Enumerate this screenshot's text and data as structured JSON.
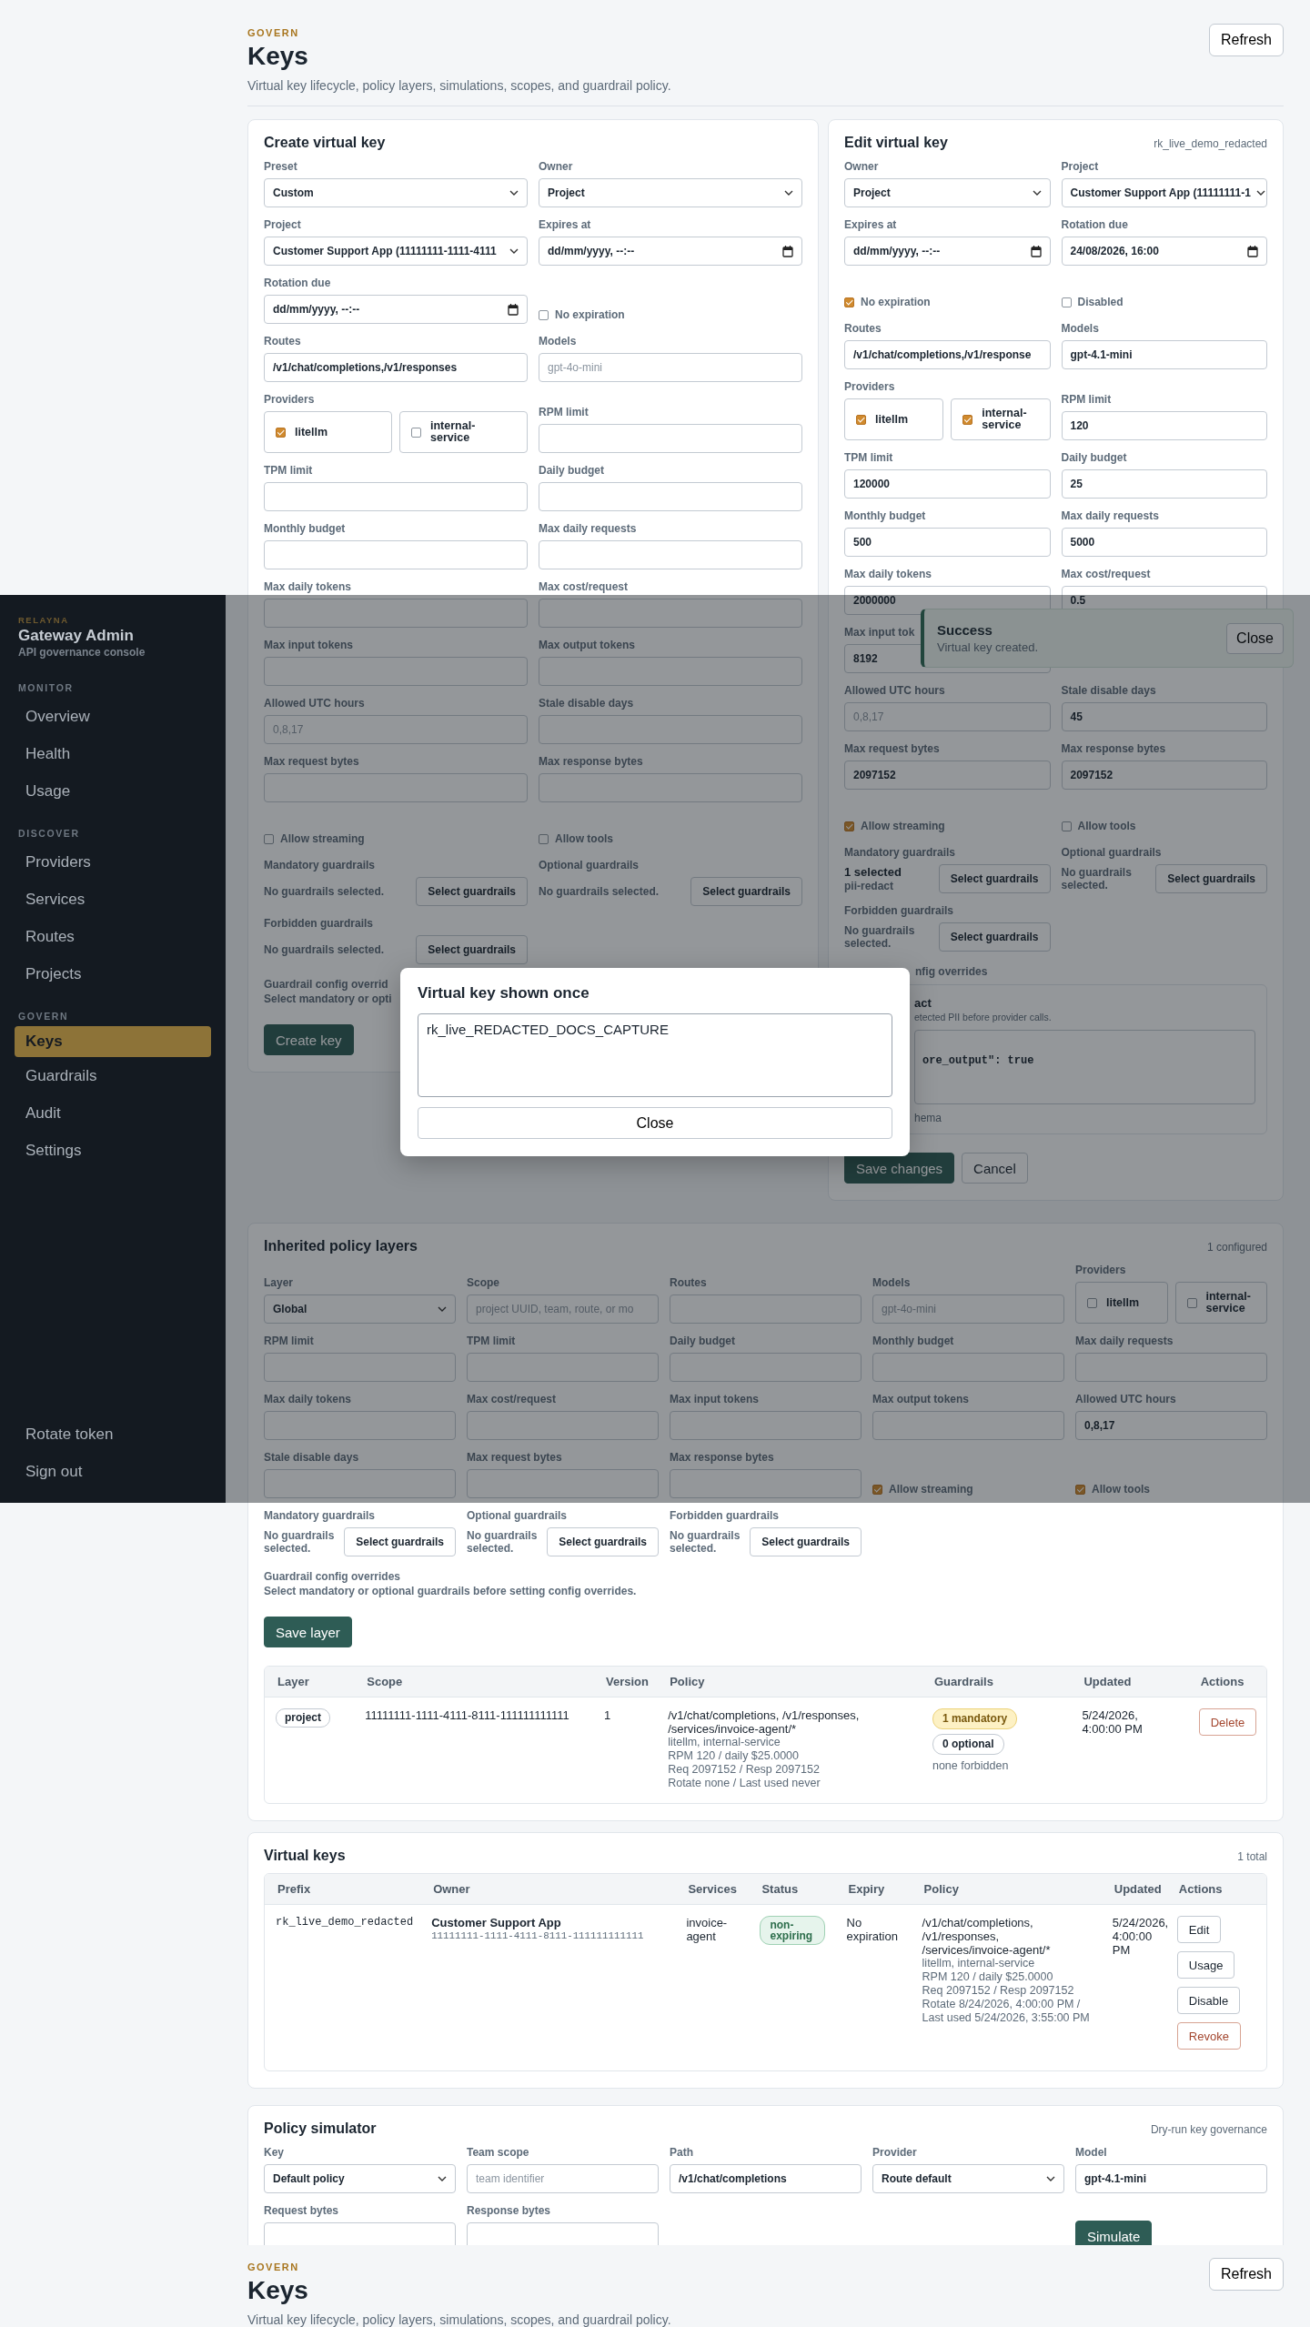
{
  "page_header": {
    "eyebrow": "GOVERN",
    "title": "Keys",
    "subtitle": "Virtual key lifecycle, policy layers, simulations, scopes, and guardrail policy.",
    "refresh": "Refresh"
  },
  "create_card": {
    "title": "Create virtual key",
    "fields": [
      {
        "kind": "select",
        "label": "Preset",
        "value": "Custom"
      },
      {
        "kind": "select",
        "label": "Owner",
        "value": "Project"
      },
      {
        "kind": "select",
        "label": "Project",
        "value": "Customer Support App (11111111-1111-4111"
      },
      {
        "kind": "date",
        "label": "Expires at",
        "value": "dd/mm/yyyy, --:--"
      },
      {
        "kind": "date",
        "label": "Rotation due",
        "value": "dd/mm/yyyy, --:--"
      },
      {
        "kind": "checkbox",
        "label": "No expiration",
        "checked": false
      },
      {
        "kind": "input",
        "label": "Routes",
        "value": "/v1/chat/completions,/v1/responses"
      },
      {
        "kind": "input",
        "label": "Models",
        "placeholder": "gpt-4o-mini"
      },
      {
        "kind": "providers",
        "label": "Providers",
        "options": [
          {
            "label": "litellm",
            "checked": true
          },
          {
            "label": "internal-service",
            "checked": false
          }
        ]
      },
      {
        "kind": "input",
        "label": "RPM limit"
      },
      {
        "kind": "input",
        "label": "TPM limit"
      },
      {
        "kind": "input",
        "label": "Daily budget"
      },
      {
        "kind": "input",
        "label": "Monthly budget"
      },
      {
        "kind": "input",
        "label": "Max daily requests"
      },
      {
        "kind": "input",
        "label": "Max daily tokens"
      },
      {
        "kind": "input",
        "label": "Max cost/request"
      },
      {
        "kind": "input",
        "label": "Max input tokens"
      },
      {
        "kind": "input",
        "label": "Max output tokens"
      },
      {
        "kind": "input",
        "label": "Allowed UTC hours",
        "placeholder": "0,8,17"
      },
      {
        "kind": "input",
        "label": "Stale disable days"
      },
      {
        "kind": "input",
        "label": "Max request bytes"
      },
      {
        "kind": "input",
        "label": "Max response bytes"
      },
      {
        "kind": "checkbox",
        "label": "Allow streaming",
        "checked": false
      },
      {
        "kind": "checkbox",
        "label": "Allow tools",
        "checked": false
      },
      {
        "kind": "guardrails",
        "label": "Mandatory guardrails",
        "summary": "No guardrails selected.",
        "button": "Select guardrails"
      },
      {
        "kind": "guardrails",
        "label": "Optional guardrails",
        "summary": "No guardrails selected.",
        "button": "Select guardrails"
      },
      {
        "kind": "guardrails",
        "label": "Forbidden guardrails",
        "summary": "No guardrails selected.",
        "button": "Select guardrails"
      }
    ],
    "config_note": {
      "label": "Guardrail config overrid",
      "text": "Select mandatory or opti"
    },
    "buttons": [
      "Create key"
    ]
  },
  "edit_card": {
    "title": "Edit virtual key",
    "meta": "rk_live_demo_redacted",
    "fields": [
      {
        "kind": "select",
        "label": "Owner",
        "value": "Project"
      },
      {
        "kind": "select",
        "label": "Project",
        "value": "Customer Support App (11111111-1"
      },
      {
        "kind": "date",
        "label": "Expires at",
        "value": "dd/mm/yyyy, --:--"
      },
      {
        "kind": "date",
        "label": "Rotation due",
        "value": "24/08/2026, 16:00"
      },
      {
        "kind": "checkbox",
        "label": "No expiration",
        "checked": true
      },
      {
        "kind": "checkbox",
        "label": "Disabled",
        "checked": false
      },
      {
        "kind": "input",
        "label": "Routes",
        "value": "/v1/chat/completions,/v1/response"
      },
      {
        "kind": "input",
        "label": "Models",
        "value": "gpt-4.1-mini"
      },
      {
        "kind": "providers",
        "label": "Providers",
        "options": [
          {
            "label": "litellm",
            "checked": true
          },
          {
            "label": "internal-service",
            "checked": true
          }
        ]
      },
      {
        "kind": "input",
        "label": "RPM limit",
        "value": "120"
      },
      {
        "kind": "input",
        "label": "TPM limit",
        "value": "120000"
      },
      {
        "kind": "input",
        "label": "Daily budget",
        "value": "25"
      },
      {
        "kind": "input",
        "label": "Monthly budget",
        "value": "500"
      },
      {
        "kind": "input",
        "label": "Max daily requests",
        "value": "5000"
      },
      {
        "kind": "input",
        "label": "Max daily tokens",
        "value": "2000000"
      },
      {
        "kind": "input",
        "label": "Max cost/request",
        "value": "0.5"
      },
      {
        "kind": "input",
        "label": "Max input tok",
        "value": "8192"
      },
      {
        "kind": "gap"
      },
      {
        "kind": "input",
        "label": "Allowed UTC hours",
        "placeholder": "0,8,17"
      },
      {
        "kind": "input",
        "label": "Stale disable days",
        "value": "45"
      },
      {
        "kind": "input",
        "label": "Max request bytes",
        "value": "2097152"
      },
      {
        "kind": "input",
        "label": "Max response bytes",
        "value": "2097152"
      },
      {
        "kind": "checkbox",
        "label": "Allow streaming",
        "checked": true
      },
      {
        "kind": "checkbox",
        "label": "Allow tools",
        "checked": false
      },
      {
        "kind": "guardrails",
        "label": "Mandatory guardrails",
        "summary": "1 selected",
        "items": [
          "pii-redact"
        ],
        "button": "Select guardrails"
      },
      {
        "kind": "guardrails",
        "label": "Optional guardrails",
        "summary": "No guardrails selected.",
        "button": "Select guardrails"
      },
      {
        "kind": "guardrails",
        "label": "Forbidden guardrails",
        "summary": "No guardrails selected.",
        "button": "Select guardrails"
      }
    ],
    "config": {
      "label": "nfig overrides",
      "name": "act",
      "description": "etected PII before provider calls.",
      "json": "ore_output\": true",
      "footer": "hema"
    },
    "buttons": [
      "Save changes",
      "Cancel"
    ]
  },
  "layers_card": {
    "title": "Inherited policy layers",
    "meta": "1 configured",
    "fields": [
      {
        "kind": "select",
        "label": "Layer",
        "value": "Global"
      },
      {
        "kind": "input",
        "label": "Scope",
        "placeholder": "project UUID, team, route, or mo"
      },
      {
        "kind": "input",
        "label": "Routes"
      },
      {
        "kind": "input",
        "label": "Models",
        "placeholder": "gpt-4o-mini"
      },
      {
        "kind": "providers",
        "label": "Providers",
        "options": [
          {
            "label": "litellm",
            "checked": false
          },
          {
            "label": "internal-service",
            "checked": false
          }
        ]
      },
      {
        "kind": "input",
        "label": "RPM limit"
      },
      {
        "kind": "input",
        "label": "TPM limit"
      },
      {
        "kind": "input",
        "label": "Daily budget"
      },
      {
        "kind": "input",
        "label": "Monthly budget"
      },
      {
        "kind": "input",
        "label": "Max daily requests"
      },
      {
        "kind": "input",
        "label": "Max daily tokens"
      },
      {
        "kind": "input",
        "label": "Max cost/request"
      },
      {
        "kind": "input",
        "label": "Max input tokens"
      },
      {
        "kind": "input",
        "label": "Max output tokens"
      },
      {
        "kind": "input",
        "label": "Allowed UTC hours",
        "value": "0,8,17"
      },
      {
        "kind": "input",
        "label": "Stale disable days"
      },
      {
        "kind": "input",
        "label": "Max request bytes"
      },
      {
        "kind": "input",
        "label": "Max response bytes"
      },
      {
        "kind": "checkbox",
        "label": "Allow streaming",
        "checked": true
      },
      {
        "kind": "checkbox",
        "label": "Allow tools",
        "checked": true
      },
      {
        "kind": "guardrails",
        "label": "Mandatory guardrails",
        "summary": "No guardrails selected.",
        "button": "Select guardrails"
      },
      {
        "kind": "guardrails",
        "label": "Optional guardrails",
        "summary": "No guardrails selected.",
        "button": "Select guardrails"
      },
      {
        "kind": "guardrails",
        "label": "Forbidden guardrails",
        "summary": "No guardrails selected.",
        "button": "Select guardrails"
      }
    ],
    "config_note": {
      "label": "Guardrail config overrides",
      "text": "Select mandatory or optional guardrails before setting config overrides."
    },
    "buttons": [
      "Save layer"
    ],
    "table": {
      "columns": [
        "Layer",
        "Scope",
        "Version",
        "Policy",
        "Guardrails",
        "Updated",
        "Actions"
      ],
      "rows": [
        {
          "layer": "project",
          "scope": "11111111-1111-4111-8111-111111111111",
          "version": "1",
          "policy": {
            "routes": "/v1/chat/completions, /v1/responses, /services/invoice-agent/*",
            "details": [
              "litellm, internal-service",
              "RPM 120 / daily $25.0000",
              "Req 2097152 / Resp 2097152",
              "Rotate none / Last used never"
            ]
          },
          "guardrails": {
            "badges": [
              {
                "label": "1 mandatory",
                "kind": "warning"
              },
              {
                "label": "0 optional",
                "kind": "neutral"
              }
            ],
            "note": "none forbidden"
          },
          "updated": "5/24/2026, 4:00:00 PM",
          "actions": [
            {
              "label": "Delete",
              "kind": "danger"
            }
          ]
        }
      ]
    }
  },
  "virtual_keys": {
    "title": "Virtual keys",
    "meta": "1 total",
    "columns": [
      "Prefix",
      "Owner",
      "Services",
      "Status",
      "Expiry",
      "Policy",
      "Updated",
      "Actions"
    ],
    "rows": [
      {
        "prefix": "rk_live_demo_redacted",
        "owner_name": "Customer Support App",
        "owner_id": "11111111-1111-4111-8111-111111111111",
        "services": "invoice-agent",
        "status": {
          "label": "non-expiring",
          "kind": "success"
        },
        "expiry": "No expiration",
        "policy": {
          "routes": "/v1/chat/completions, /v1/responses, /services/invoice-agent/*",
          "details": [
            "litellm, internal-service",
            "RPM 120 / daily $25.0000",
            "Req 2097152 / Resp 2097152",
            "Rotate 8/24/2026, 4:00:00 PM / Last used 5/24/2026, 3:55:00 PM"
          ]
        },
        "updated": "5/24/2026, 4:00:00 PM",
        "actions": [
          {
            "label": "Edit",
            "kind": "default"
          },
          {
            "label": "Usage",
            "kind": "default"
          },
          {
            "label": "Disable",
            "kind": "default"
          },
          {
            "label": "Revoke",
            "kind": "danger"
          }
        ]
      }
    ]
  },
  "policy_simulator": {
    "title": "Policy simulator",
    "meta": "Dry-run key governance",
    "fields": [
      {
        "kind": "select",
        "label": "Key",
        "value": "Default policy"
      },
      {
        "kind": "input",
        "label": "Team scope",
        "placeholder": "team identifier"
      },
      {
        "kind": "input",
        "label": "Path",
        "value": "/v1/chat/completions"
      },
      {
        "kind": "select",
        "label": "Provider",
        "value": "Route default"
      },
      {
        "kind": "input",
        "label": "Model",
        "value": "gpt-4.1-mini"
      },
      {
        "kind": "input",
        "label": "Request bytes"
      },
      {
        "kind": "input",
        "label": "Response bytes"
      },
      {
        "kind": "gap"
      },
      {
        "kind": "gap"
      },
      {
        "kind": "button",
        "label": "Simulate"
      }
    ]
  },
  "page_header_repeat": {
    "eyebrow": "GOVERN",
    "title": "Keys",
    "subtitle": "Virtual key lifecycle, policy layers, simulations, scopes, and guardrail policy.",
    "refresh": "Refresh"
  },
  "sidebar": {
    "eyebrow": "RELAYNA",
    "title": "Gateway Admin",
    "tagline": "API governance console",
    "sections": [
      {
        "title": "MONITOR",
        "items": [
          {
            "label": "Overview",
            "selected": false
          },
          {
            "label": "Health",
            "selected": false
          },
          {
            "label": "Usage",
            "selected": false
          }
        ]
      },
      {
        "title": "DISCOVER",
        "items": [
          {
            "label": "Providers",
            "selected": false
          },
          {
            "label": "Services",
            "selected": false
          },
          {
            "label": "Routes",
            "selected": false
          },
          {
            "label": "Projects",
            "selected": false
          }
        ]
      },
      {
        "title": "GOVERN",
        "items": [
          {
            "label": "Keys",
            "selected": true
          },
          {
            "label": "Guardrails",
            "selected": false
          },
          {
            "label": "Audit",
            "selected": false
          },
          {
            "label": "Settings",
            "selected": false
          }
        ]
      }
    ],
    "footer_items": [
      "Rotate token",
      "Sign out"
    ]
  },
  "toast": {
    "title": "Success",
    "message": "Virtual key created.",
    "close": "Close"
  },
  "modal": {
    "title": "Virtual key shown once",
    "value": "rk_live_REDACTED_DOCS_CAPTURE",
    "close": "Close"
  }
}
